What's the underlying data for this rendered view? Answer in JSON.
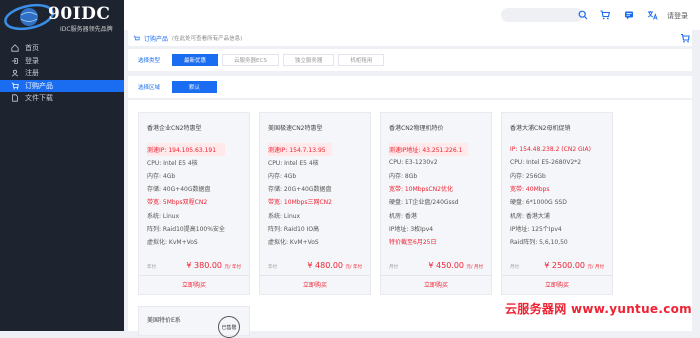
{
  "brand": {
    "name": "90IDC",
    "tagline": "IDC服务器领先品牌"
  },
  "sidebar": {
    "items": [
      {
        "label": "首页",
        "icon": "home-icon"
      },
      {
        "label": "登录",
        "icon": "login-icon"
      },
      {
        "label": "注册",
        "icon": "register-icon"
      },
      {
        "label": "订购产品",
        "icon": "cart-icon",
        "active": true
      },
      {
        "label": "文件下载",
        "icon": "download-icon"
      }
    ]
  },
  "topbar": {
    "login": "请登录"
  },
  "breadcrumb": {
    "crumb": "订购产品",
    "hint": "(在此处可查看所有产品信息)"
  },
  "filters": {
    "type_label": "选择类型",
    "types": [
      "最新优惠",
      "云服务器ECS",
      "独立服务器",
      "机柜租用"
    ],
    "region_label": "选择区域",
    "region": "默认"
  },
  "products": [
    {
      "title": "香港企业CN2特惠型",
      "specs": [
        "测速IP: 194.105.63.191",
        "CPU: Intel E5 4核",
        "内存: 4Gb",
        "存储: 40G+40G数据盘",
        "带宽: 5Mbps双程CN2",
        "系统: Linux",
        "阵列: Raid10提高100%安全",
        "虚拟化: KvM+VoS"
      ],
      "period": "年付",
      "price": "¥ 380.00",
      "unit": "元/ 年付",
      "buy": "立即购买"
    },
    {
      "title": "美国极速CN2特惠型",
      "specs": [
        "测速IP: 154.7.13.95",
        "CPU: Intel E5 4核",
        "内存: 4Gb",
        "存储: 20G+40G数据盘",
        "带宽: 10Mbps三网CN2",
        "系统: Linux",
        "阵列: Raid10 IO高",
        "虚拟化: KvM+VoS"
      ],
      "period": "年付",
      "price": "¥ 480.00",
      "unit": "元/ 年付",
      "buy": "立即购买"
    },
    {
      "title": "香港CN2物理机特价",
      "specs": [
        "测速IP地址: 43.251.226.1",
        "CPU: E3-1230v2",
        "内存: 8Gb",
        "宽带: 10MbpsCN2优化",
        "硬盘: 1T企业盘/240Gssd",
        "机房: 香港",
        "IP地址: 3枚Ipv4",
        "特价截至6月25日"
      ],
      "period": "月付",
      "price": "¥ 450.00",
      "unit": "元/ 月付",
      "buy": "立即购买"
    },
    {
      "title": "香港大浦CN2母机促销",
      "specs": [
        "IP: 154.48.238.2 (CN2 GIA)",
        "CPU: Intel E5-2680V2*2",
        "内存: 256Gb",
        "宽带: 40Mbps",
        "硬盘: 6*1000G SSD",
        "机房: 香港大浦",
        "IP地址: 125个Ipv4",
        "Raid阵列: 5,6,10,50"
      ],
      "period": "月付",
      "price": "¥ 2500.00",
      "unit": "元/ 月付",
      "buy": "立即购买"
    }
  ],
  "partial_card": {
    "title": "美国特价E系"
  },
  "stamp_text": "已售罄",
  "watermark": "云服务器网 www.yuntue.com",
  "colors": {
    "accent": "#1a6cf0",
    "price_red": "#e22233",
    "sidebar_bg": "#1e2330"
  }
}
